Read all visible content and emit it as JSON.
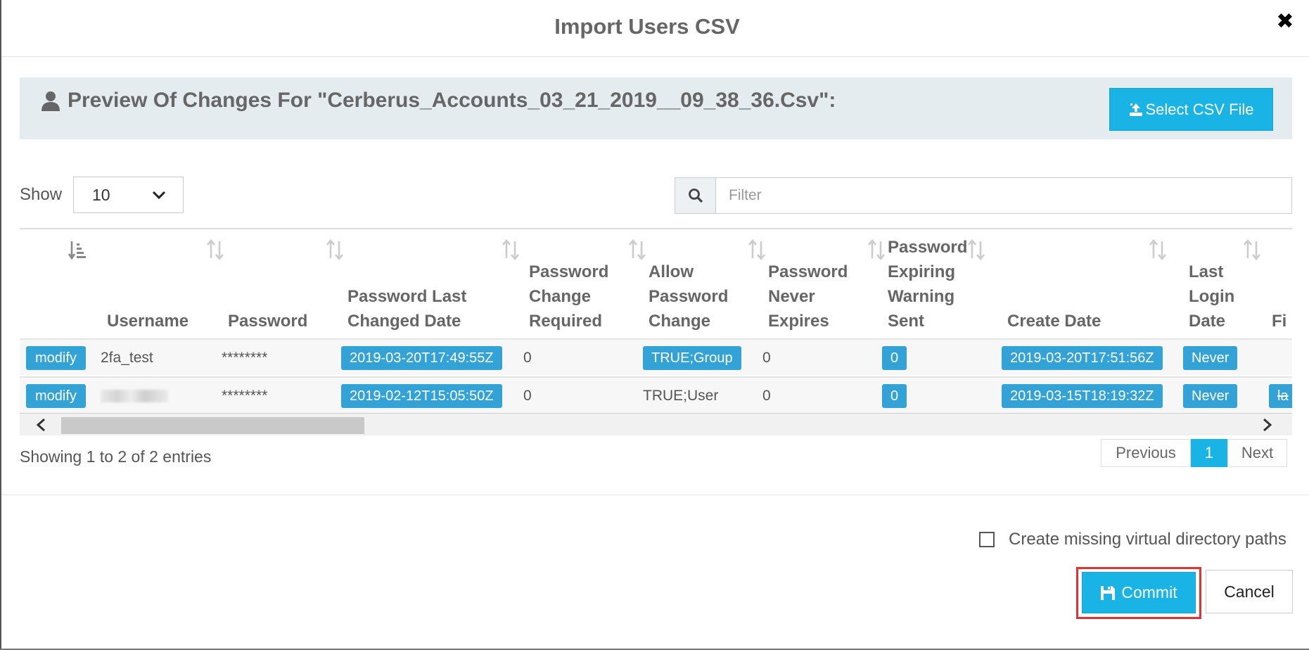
{
  "modal": {
    "title": "Import Users CSV",
    "close_symbol": "✖"
  },
  "preview": {
    "icon": "user-icon",
    "title": "Preview Of Changes For \"Cerberus_Accounts_03_21_2019__09_38_36.Csv\":",
    "select_button": "Select CSV File",
    "select_button_icon": "upload-icon"
  },
  "length_menu": {
    "label": "Show",
    "value": "10"
  },
  "filter": {
    "icon": "search-icon",
    "placeholder": "Filter"
  },
  "table": {
    "columns": [
      "",
      "Username",
      "Password",
      "Password Last Changed Date",
      "Password Change Required",
      "Allow Password Change",
      "Password Never Expires",
      "Password Expiring Warning Sent",
      "Create Date",
      "Last Login Date",
      "Fi"
    ],
    "rows": [
      {
        "action": "modify",
        "username": "2fa_test",
        "password": "********",
        "password_last_changed": "2019-03-20T17:49:55Z",
        "password_change_required": "0",
        "allow_password_change": "TRUE;Group",
        "password_never_expires": "0",
        "password_expiring_warning_sent": "0",
        "create_date": "2019-03-20T17:51:56Z",
        "last_login_date": "Never",
        "first": ""
      },
      {
        "action": "modify",
        "username": "",
        "password": "********",
        "password_last_changed": "2019-02-12T15:05:50Z",
        "password_change_required": "0",
        "allow_password_change": "TRUE;User",
        "password_never_expires": "0",
        "password_expiring_warning_sent": "0",
        "create_date": "2019-03-15T18:19:32Z",
        "last_login_date": "Never",
        "first": "la"
      }
    ]
  },
  "info": "Showing 1 to 2 of 2 entries",
  "pagination": {
    "previous": "Previous",
    "current": "1",
    "next": "Next"
  },
  "options": {
    "create_missing_paths": "Create missing virtual directory paths",
    "create_missing_paths_checked": false
  },
  "footer": {
    "commit": "Commit",
    "commit_icon": "save-icon",
    "cancel": "Cancel"
  },
  "colors": {
    "primary": "#1ab3e5",
    "badge": "#33a2d6",
    "highlight_outline": "#e03434",
    "preview_bar": "#e5ecef"
  }
}
